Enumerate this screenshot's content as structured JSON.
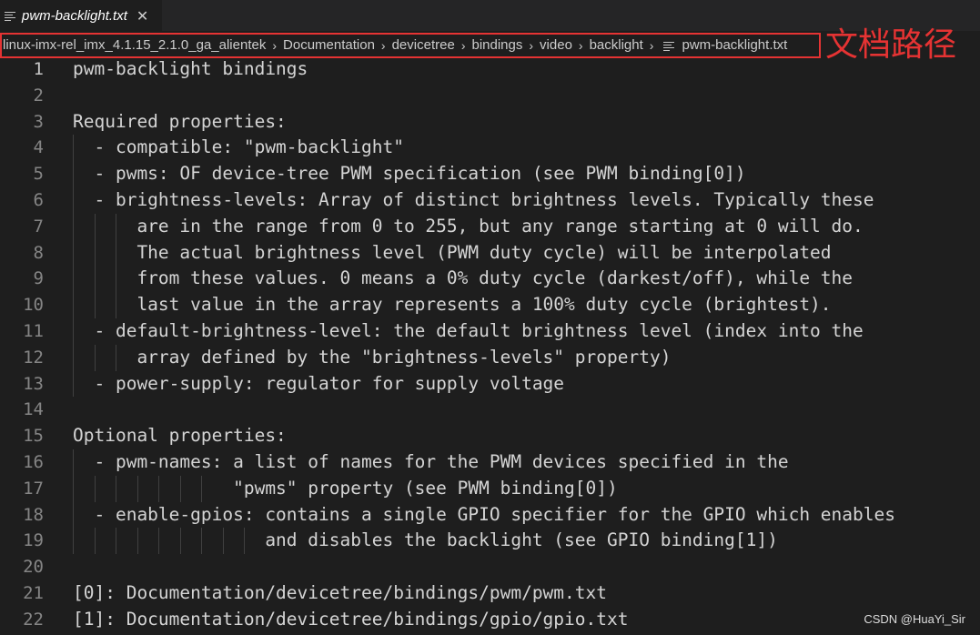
{
  "tab": {
    "title": "pwm-backlight.txt",
    "close_glyph": "✕",
    "icon": "file-lines-icon"
  },
  "breadcrumb": {
    "items": [
      "linux-imx-rel_imx_4.1.15_2.1.0_ga_alientek",
      "Documentation",
      "devicetree",
      "bindings",
      "video",
      "backlight"
    ],
    "file": "pwm-backlight.txt",
    "separator": "›"
  },
  "annotation": {
    "text": "文档路径",
    "color": "#e53333"
  },
  "editor": {
    "active_line": 1,
    "lines": [
      {
        "n": "1",
        "text": "pwm-backlight bindings"
      },
      {
        "n": "2",
        "text": ""
      },
      {
        "n": "3",
        "text": "Required properties:"
      },
      {
        "n": "4",
        "text": "  - compatible: \"pwm-backlight\""
      },
      {
        "n": "5",
        "text": "  - pwms: OF device-tree PWM specification (see PWM binding[0])"
      },
      {
        "n": "6",
        "text": "  - brightness-levels: Array of distinct brightness levels. Typically these"
      },
      {
        "n": "7",
        "text": "      are in the range from 0 to 255, but any range starting at 0 will do."
      },
      {
        "n": "8",
        "text": "      The actual brightness level (PWM duty cycle) will be interpolated"
      },
      {
        "n": "9",
        "text": "      from these values. 0 means a 0% duty cycle (darkest/off), while the"
      },
      {
        "n": "10",
        "text": "      last value in the array represents a 100% duty cycle (brightest)."
      },
      {
        "n": "11",
        "text": "  - default-brightness-level: the default brightness level (index into the"
      },
      {
        "n": "12",
        "text": "      array defined by the \"brightness-levels\" property)"
      },
      {
        "n": "13",
        "text": "  - power-supply: regulator for supply voltage"
      },
      {
        "n": "14",
        "text": ""
      },
      {
        "n": "15",
        "text": "Optional properties:"
      },
      {
        "n": "16",
        "text": "  - pwm-names: a list of names for the PWM devices specified in the"
      },
      {
        "n": "17",
        "text": "               \"pwms\" property (see PWM binding[0])"
      },
      {
        "n": "18",
        "text": "  - enable-gpios: contains a single GPIO specifier for the GPIO which enables"
      },
      {
        "n": "19",
        "text": "                  and disables the backlight (see GPIO binding[1])"
      },
      {
        "n": "20",
        "text": ""
      },
      {
        "n": "21",
        "text": "[0]: Documentation/devicetree/bindings/pwm/pwm.txt"
      },
      {
        "n": "22",
        "text": "[1]: Documentation/devicetree/bindings/gpio/gpio.txt"
      }
    ]
  },
  "watermark": {
    "text": "CSDN @HuaYi_Sir"
  }
}
